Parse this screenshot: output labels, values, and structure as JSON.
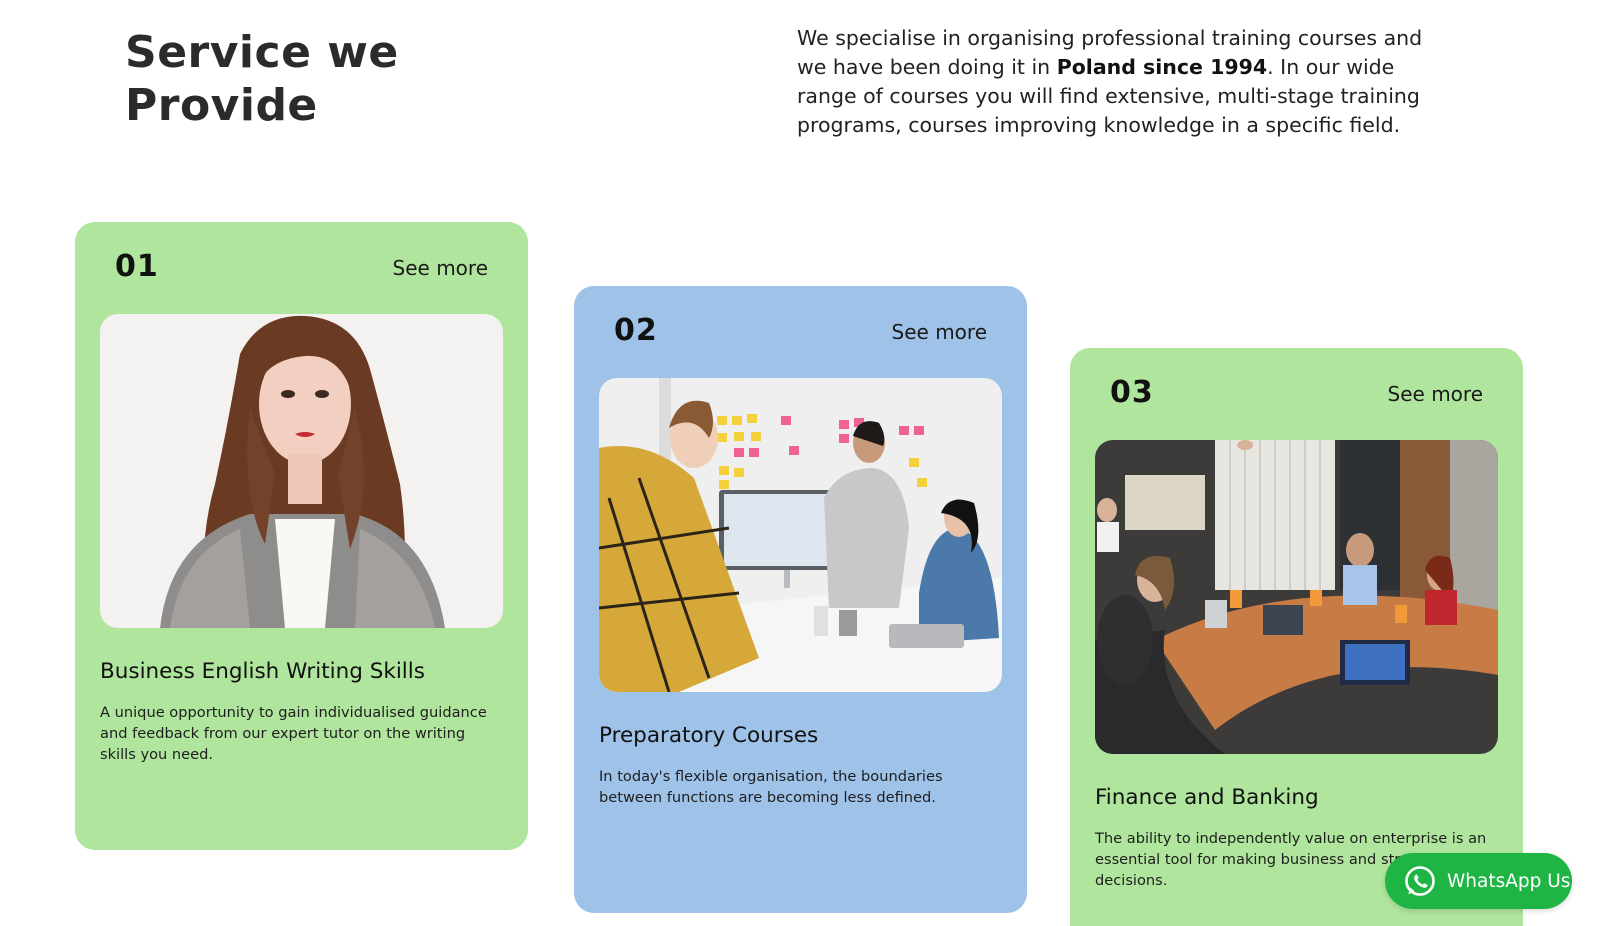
{
  "section": {
    "heading_line1": "Service we",
    "heading_line2": "Provide",
    "intro_part1": "We specialise in organising professional training courses and we have been doing it in ",
    "intro_bold": "Poland since 1994",
    "intro_part2": ". In our wide range of courses you will find extensive, multi-stage training programs, courses improving knowledge in a specific field."
  },
  "cards": [
    {
      "number": "01",
      "link": "See more",
      "title": "Business English Writing Skills",
      "description": "A unique opportunity to gain individualised guidance and feedback from our expert tutor on the writing skills you need.",
      "color": "#b0e59d",
      "image": "portrait-woman-photo"
    },
    {
      "number": "02",
      "link": "See more",
      "title": "Preparatory Courses",
      "description": "In today's flexible organisation, the boundaries between functions are becoming less defined.",
      "color": "#9ec2e8",
      "image": "team-meeting-whiteboard-photo"
    },
    {
      "number": "03",
      "link": "See more",
      "title": "Finance and Banking",
      "description": "The ability to independently value on enterprise is an essential tool for making business and strategic decisions.",
      "color": "#b0e59d",
      "image": "conference-room-training-photo"
    }
  ],
  "whatsapp": {
    "label": "WhatsApp Us",
    "color": "#1fb545",
    "icon": "whatsapp-icon"
  }
}
